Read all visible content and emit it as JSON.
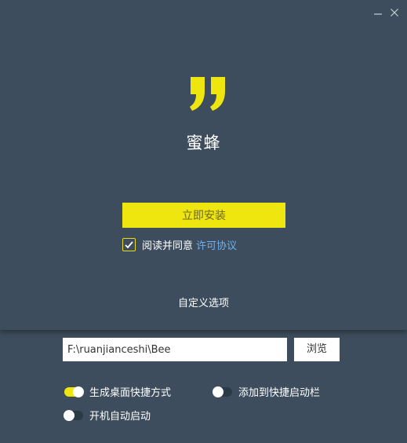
{
  "window": {
    "minimize_icon": "minimize-icon",
    "close_icon": "close-icon"
  },
  "app": {
    "name": "蜜蜂",
    "logo_icon": "quote-mark-logo",
    "accent_color": "#f0e60f",
    "background_color": "#3d4d5d"
  },
  "install": {
    "button_label": "立即安装",
    "agree_checked": true,
    "agree_text": "阅读并同意",
    "license_link": "许可协议"
  },
  "custom": {
    "label": "自定义选项"
  },
  "options_panel": {
    "path_value": "F:\\ruanjianceshi\\Bee",
    "browse_label": "浏览",
    "options": [
      {
        "label": "生成桌面快捷方式",
        "enabled": true
      },
      {
        "label": "添加到快捷启动栏",
        "enabled": false
      },
      {
        "label": "开机自动启动",
        "enabled": false
      }
    ]
  }
}
